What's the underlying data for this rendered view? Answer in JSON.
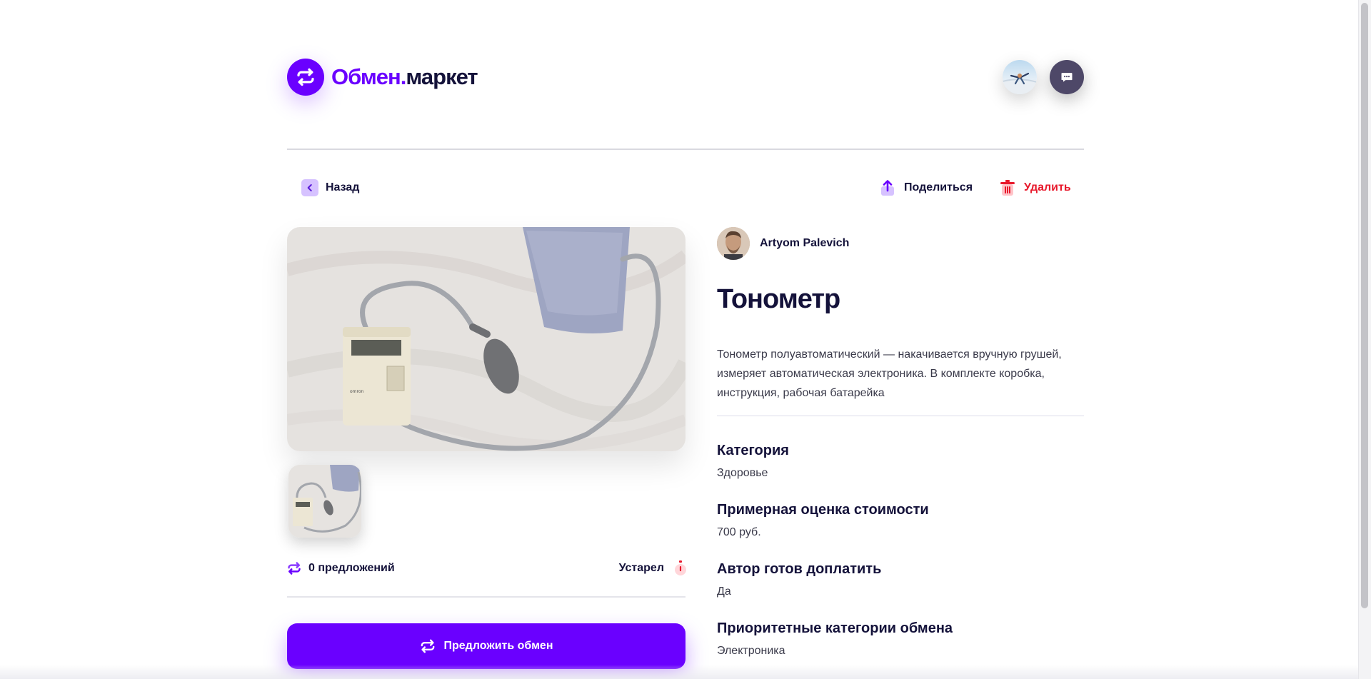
{
  "header": {
    "logo_part1": "Обмен.",
    "logo_part2": "маркет"
  },
  "actions": {
    "back_label": "Назад",
    "share_label": "Поделиться",
    "delete_label": "Удалить"
  },
  "item": {
    "author_name": "Artyom Palevich",
    "title": "Тонометр",
    "description": "Тонометр полуавтоматический — накачивается вручную грушей, измеряет автоматическая электроника. В комплекте коробка, инструкция, рабочая батарейка",
    "offers_label": "0 предложений",
    "status_label": "Устарел",
    "offer_button_label": "Предложить обмен"
  },
  "details": [
    {
      "heading": "Категория",
      "value": "Здоровье"
    },
    {
      "heading": "Примерная оценка стоимости",
      "value": "700 руб."
    },
    {
      "heading": "Автор готов доплатить",
      "value": "Да"
    },
    {
      "heading": "Приоритетные категории обмена",
      "value": "Электроника"
    }
  ],
  "colors": {
    "accent": "#6a00ff",
    "text_dark": "#14123a",
    "danger": "#e8192c",
    "chat_button": "#4e4868"
  },
  "icons": {
    "logo": "swap-arrows-icon",
    "chat": "chat-bubble-icon",
    "back": "chevron-left-icon",
    "share": "share-upload-icon",
    "delete": "trash-icon",
    "offers": "swap-arrows-icon",
    "status": "stopwatch-icon"
  }
}
